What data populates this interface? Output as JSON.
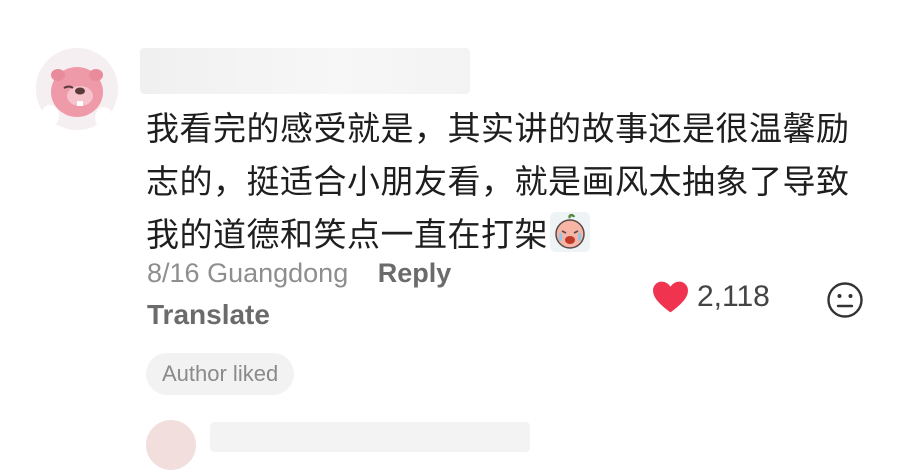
{
  "comment": {
    "text": "我看完的感受就是，其实讲的故事还是很温馨励志的，挺适合小朋友看，就是画风太抽象了导致我的道德和笑点一直在打架",
    "date": "8/16",
    "location": "Guangdong",
    "reply_label": "Reply",
    "translate_label": "Translate",
    "like_count": "2,118",
    "author_liked_label": "Author liked"
  },
  "icons": {
    "avatar": "pink-beaver-avatar",
    "emoji": "crying-peach-emoji",
    "like": "heart-icon",
    "dislike": "neutral-face-icon"
  },
  "colors": {
    "heart": "#f0334f",
    "secondary_text": "#8e8e8e",
    "badge_bg": "#f2f2f2"
  }
}
